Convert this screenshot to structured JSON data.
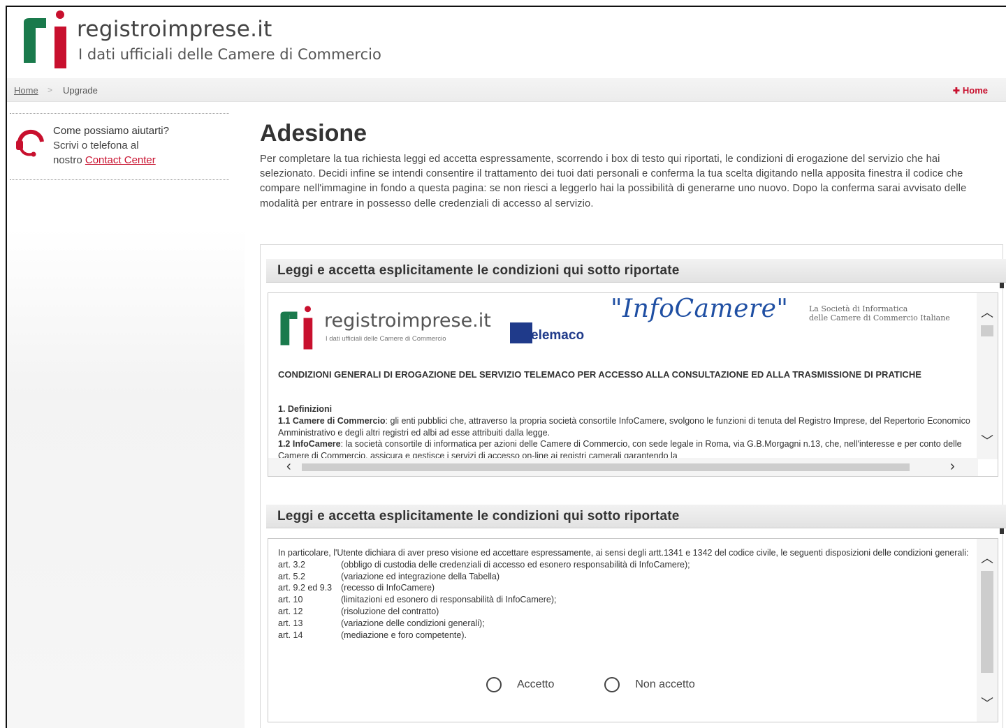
{
  "header": {
    "site_name": "registroimprese.it",
    "tagline": "I dati ufficiali delle Camere di Commercio"
  },
  "breadcrumb": {
    "home": "Home",
    "separator": ">",
    "current": "Upgrade",
    "home_link": "Home"
  },
  "sidebar": {
    "help_title": "Come possiamo aiutarti?",
    "help_line2": "Scrivi o telefona al",
    "help_line3_prefix": "nostro",
    "help_link": "Contact Center"
  },
  "main": {
    "title": "Adesione",
    "intro": "Per completare la tua richiesta leggi ed accetta espressamente, scorrendo i box di testo qui riportati, le condizioni di erogazione del servizio che hai selezionato. Decidi infine se intendi consentire il trattamento dei tuoi dati personali e conferma la tua scelta digitando nella apposita finestra il codice che compare nell'immagine in fondo a questa pagina: se non riesci a leggerlo hai la possibilità di generarne uno nuovo. Dopo la conferma sarai avvisato delle modalità per entrare in possesso delle credenziali di accesso al servizio."
  },
  "section1": {
    "heading": "Leggi e accetta esplicitamente le condizioni qui sotto riportate",
    "doc": {
      "logo_title": "registroimprese.it",
      "logo_sub": "I dati ufficiali delle Camere di Commercio",
      "telemaco": "elemaco",
      "infocamere": "\"InfoCamere\"",
      "ic_tag1": "La Società di Informatica",
      "ic_tag2": "delle Camere di Commercio Italiane",
      "title": "CONDIZIONI GENERALI DI EROGAZIONE DEL SERVIZIO TELEMACO PER ACCESSO ALLA CONSULTAZIONE ED ALLA TRASMISSIONE DI PRATICHE",
      "def_heading": "1. Definizioni",
      "def1_term": "1.1 Camere di Commercio",
      "def1_text": ": gli enti pubblici che, attraverso la propria società consortile InfoCamere, svolgono le funzioni di tenuta del Registro Imprese, del Repertorio Economico Amministrativo e degli altri registri ed albi ad esse attribuiti dalla legge.",
      "def2_term": "1.2 InfoCamere",
      "def2_text": ": la società consortile di informatica per azioni delle Camere di Commercio, con sede legale in Roma, via G.B.Morgagni n.13, che, nell'interesse e per conto delle Camere di Commercio, assicura e gestisce i servizi di accesso on-line ai registri camerali garantendo la"
    }
  },
  "section2": {
    "heading": "Leggi e accetta esplicitamente le condizioni qui sotto riportate",
    "intro": "In particolare, l'Utente dichiara di aver preso visione ed accettare espressamente, ai sensi degli artt.1341 e 1342 del codice civile, le seguenti disposizioni delle condizioni generali:",
    "articles": [
      {
        "art": "art. 3.2",
        "desc": "(obbligo di custodia delle credenziali di accesso ed esonero responsabilità di InfoCamere);"
      },
      {
        "art": "art. 5.2",
        "desc": "(variazione ed integrazione della Tabella)"
      },
      {
        "art": "art. 9.2 ed 9.3",
        "desc": "(recesso di InfoCamere)"
      },
      {
        "art": "art. 10",
        "desc": "(limitazioni ed esonero di responsabilità di InfoCamere);"
      },
      {
        "art": "art. 12",
        "desc": "(risoluzione del contratto)"
      },
      {
        "art": "art. 13",
        "desc": "(variazione delle condizioni generali);"
      },
      {
        "art": "art. 14",
        "desc": "(mediazione e foro competente)."
      }
    ],
    "accept_label": "Accetto",
    "reject_label": "Non accetto"
  },
  "colors": {
    "brand_red": "#c8102e",
    "brand_green": "#1a7a4c",
    "telemaco_blue": "#1f3a8a"
  }
}
